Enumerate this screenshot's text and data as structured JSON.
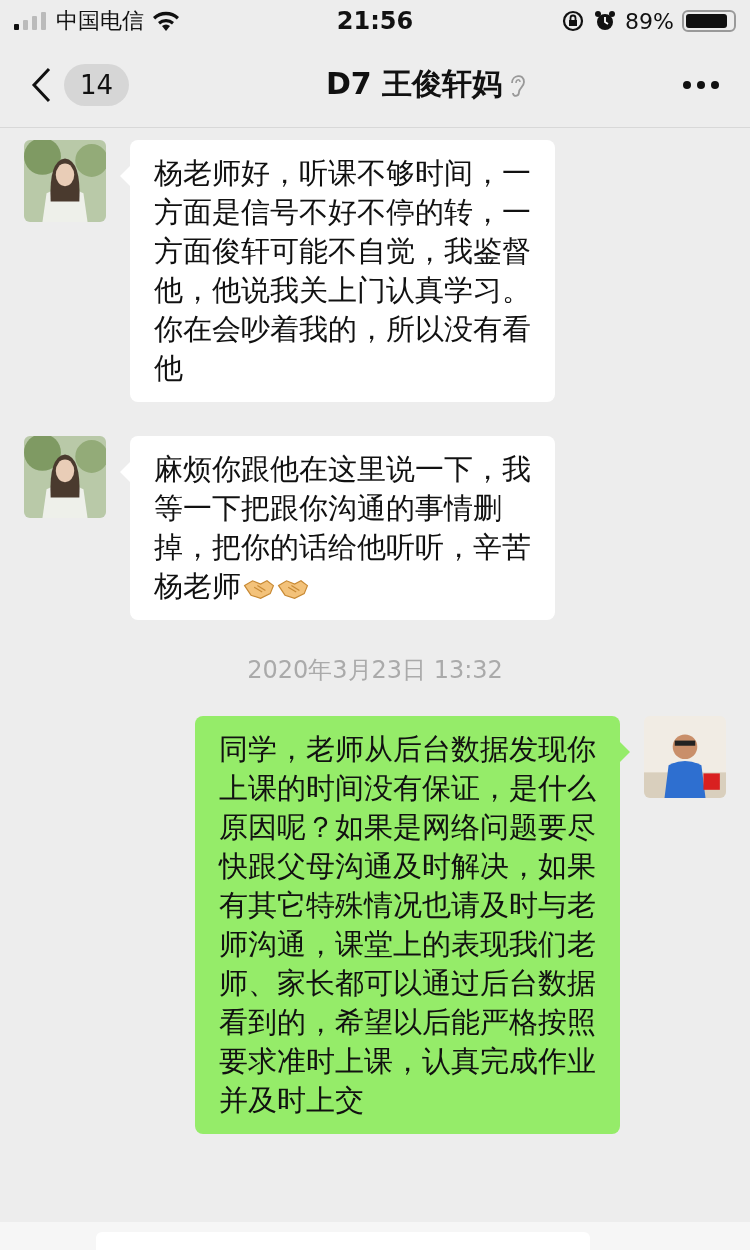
{
  "status_bar": {
    "carrier": "中国电信",
    "time": "21:56",
    "battery_text": "89%"
  },
  "header": {
    "unread_count": "14",
    "title": "D7 王俊轩妈",
    "earpiece_mode": true
  },
  "messages": [
    {
      "kind": "incoming",
      "text": "杨老师好，听课不够时间，一方面是信号不好不停的转，一方面俊轩可能不自觉，我鉴督他，他说我关上门认真学习。你在会吵着我的，所以没有看他"
    },
    {
      "kind": "incoming",
      "text": "麻烦你跟他在这里说一下，我等一下把跟你沟通的事情删掉，把你的话给他听听，辛苦杨老师",
      "emoji": [
        {
          "kind": "handshake"
        },
        {
          "kind": "handshake"
        }
      ]
    },
    {
      "kind": "time",
      "text": "2020年3月23日 13:32"
    },
    {
      "kind": "outgoing",
      "text": "同学，老师从后台数据发现你上课的时间没有保证，是什么原因呢？如果是网络问题要尽快跟父母沟通及时解决，如果有其它特殊情况也请及时与老师沟通，课堂上的表现我们老师、家长都可以通过后台数据看到的，希望以后能严格按照要求准时上课，认真完成作业并及时上交"
    }
  ]
}
